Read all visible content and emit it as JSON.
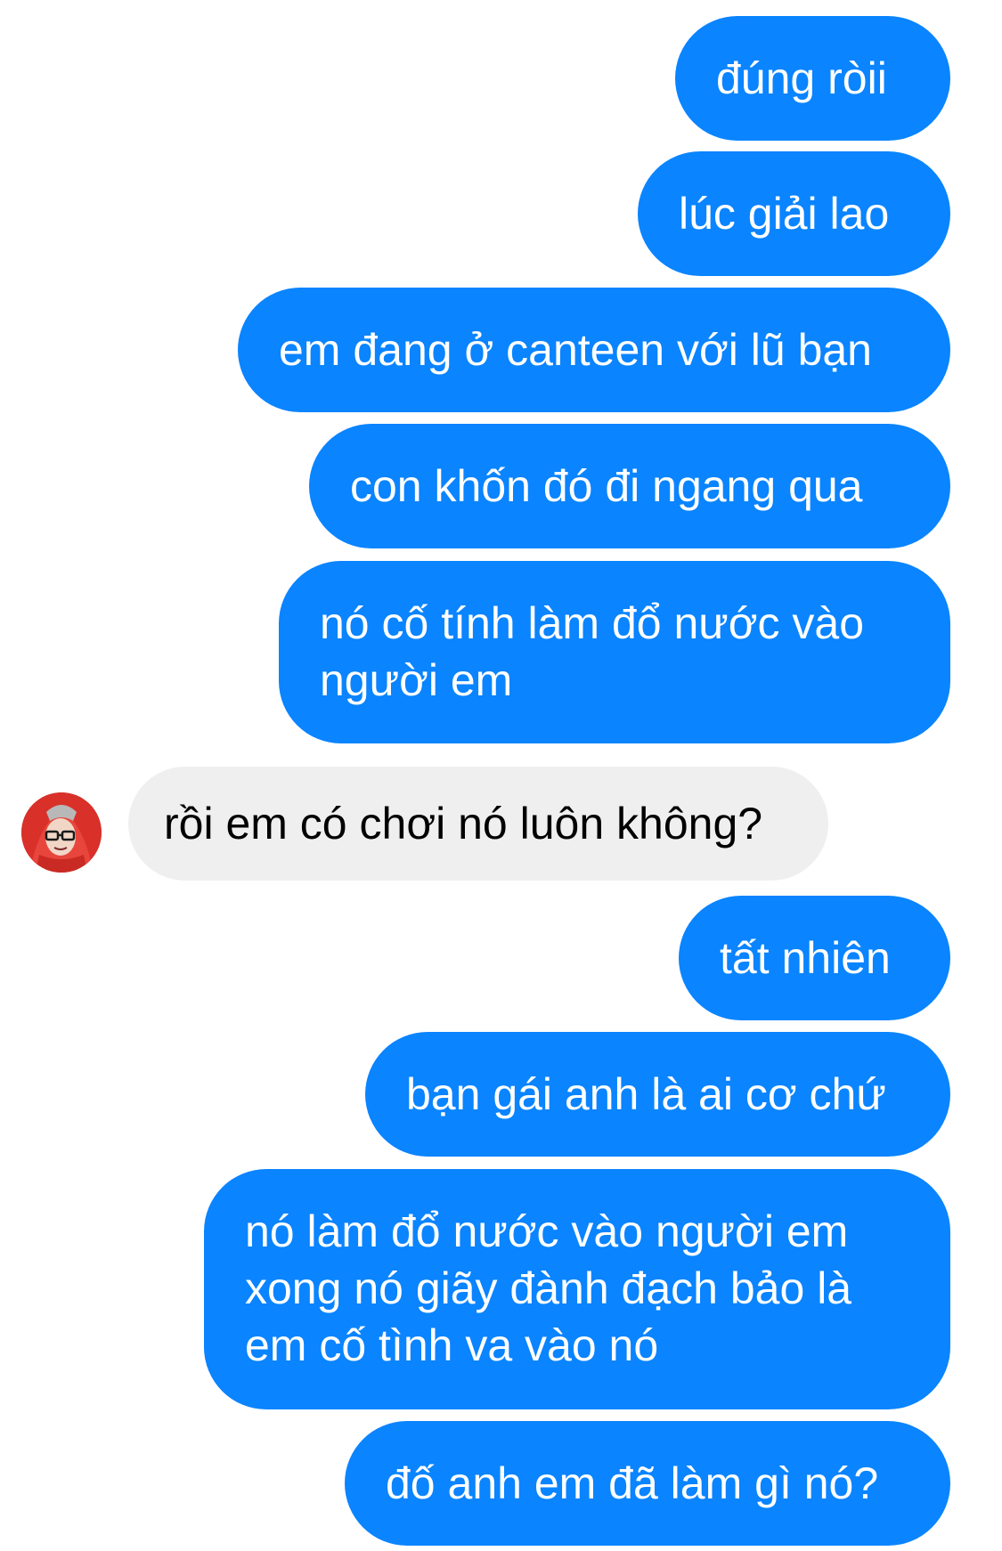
{
  "conversation": {
    "messages": [
      {
        "sender": "me",
        "text": "đúng ròii"
      },
      {
        "sender": "me",
        "text": "lúc giải lao"
      },
      {
        "sender": "me",
        "text": "em đang ở canteen với lũ bạn"
      },
      {
        "sender": "me",
        "text": "con khốn đó đi ngang qua"
      },
      {
        "sender": "me",
        "lines": [
          "nó cố tính làm đổ nước vào",
          "người em"
        ]
      },
      {
        "sender": "them",
        "text": "rồi em có chơi nó luôn không?",
        "avatar": "avatar-red-hood-glasses"
      },
      {
        "sender": "me",
        "text": "tất nhiên"
      },
      {
        "sender": "me",
        "text": "bạn gái anh là ai cơ chứ"
      },
      {
        "sender": "me",
        "lines": [
          "nó làm đổ nước vào người em",
          "xong nó giãy đành đạch bảo là",
          "em cố tình va vào nó"
        ]
      },
      {
        "sender": "me",
        "text": "đố anh em đã làm gì nó?"
      }
    ]
  },
  "colors": {
    "outgoing_bubble": "#0a84ff",
    "incoming_bubble": "#efefef",
    "outgoing_text": "#ffffff",
    "incoming_text": "#000000",
    "avatar_hood": "#d9302a"
  }
}
